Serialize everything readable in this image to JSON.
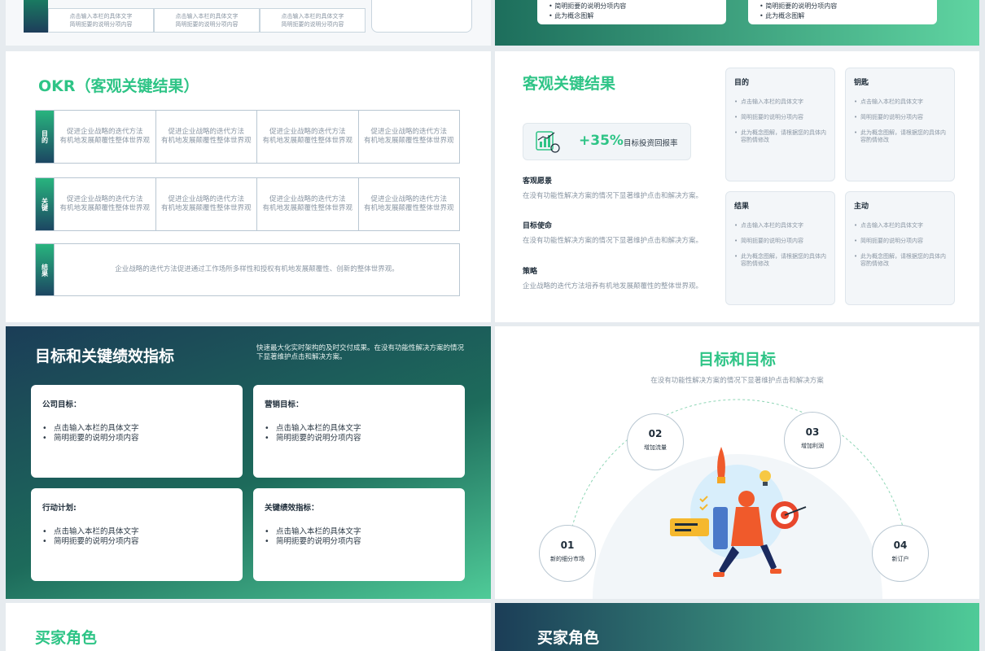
{
  "top_left": {
    "cells": [
      {
        "line1": "点击输入本栏的具体文字",
        "line2": "简明扼要的说明分项内容"
      },
      {
        "line1": "点击输入本栏的具体文字",
        "line2": "简明扼要的说明分项内容"
      },
      {
        "line1": "点击输入本栏的具体文字",
        "line2": "简明扼要的说明分项内容"
      }
    ]
  },
  "top_right": {
    "cards": [
      {
        "line1": "• 简明扼要的说明分项内容",
        "line2": "• 此为概念图解"
      },
      {
        "line1": "• 简明扼要的说明分项内容",
        "line2": "• 此为概念图解"
      }
    ]
  },
  "okr": {
    "title": "OKR（客观关键结果）",
    "rows": [
      {
        "tag": "目的",
        "cells": [
          "促进企业战略的迭代方法\n有机地发展颠覆性整体世界观",
          "促进企业战略的迭代方法\n有机地发展颠覆性整体世界观",
          "促进企业战略的迭代方法\n有机地发展颠覆性整体世界观",
          "促进企业战略的迭代方法\n有机地发展颠覆性整体世界观"
        ]
      },
      {
        "tag": "关键",
        "cells": [
          "促进企业战略的迭代方法\n有机地发展颠覆性整体世界观",
          "促进企业战略的迭代方法\n有机地发展颠覆性整体世界观",
          "促进企业战略的迭代方法\n有机地发展颠覆性整体世界观",
          "促进企业战略的迭代方法\n有机地发展颠覆性整体世界观"
        ]
      },
      {
        "tag": "结果",
        "text": "企业战略的迭代方法促进通过工作场所多样性和授权有机地发展颠覆性、创新的整体世界观。"
      }
    ]
  },
  "kr": {
    "title": "客观关键结果",
    "stat_value": "+35%",
    "stat_label": "目标投资回报率",
    "items": [
      {
        "title": "客观愿景",
        "desc": "在没有功能性解决方案的情况下显著维护点击和解决方案。"
      },
      {
        "title": "目标使命",
        "desc": "在没有功能性解决方案的情况下显著维护点击和解决方案。"
      },
      {
        "title": "策略",
        "desc": "企业战略的迭代方法培养有机地发展颠覆性的整体世界观。"
      }
    ],
    "boxes": [
      {
        "title": "目的",
        "bullets": [
          "点击输入本栏的具体文字",
          "简明扼要的说明分项内容",
          "此为概念图解，请根据您的具体内容酌情修改"
        ]
      },
      {
        "title": "钥匙",
        "bullets": [
          "点击输入本栏的具体文字",
          "简明扼要的说明分项内容",
          "此为概念图解，请根据您的具体内容酌情修改"
        ]
      },
      {
        "title": "结果",
        "bullets": [
          "点击输入本栏的具体文字",
          "简明扼要的说明分项内容",
          "此为概念图解，请根据您的具体内容酌情修改"
        ]
      },
      {
        "title": "主动",
        "bullets": [
          "点击输入本栏的具体文字",
          "简明扼要的说明分项内容",
          "此为概念图解，请根据您的具体内容酌情修改"
        ]
      }
    ]
  },
  "kpi": {
    "title": "目标和关键绩效指标",
    "subtitle": "快速最大化实时架构的及时交付成果。在没有功能性解决方案的情况下显著维护点击和解决方案。",
    "cards": [
      {
        "title": "公司目标：",
        "bullets": [
          "点击输入本栏的具体文字",
          "简明扼要的说明分项内容"
        ]
      },
      {
        "title": "营销目标：",
        "bullets": [
          "点击输入本栏的具体文字",
          "简明扼要的说明分项内容"
        ]
      },
      {
        "title": "行动计划:",
        "bullets": [
          "点击输入本栏的具体文字",
          "简明扼要的说明分项内容"
        ]
      },
      {
        "title": "关键绩效指标：",
        "bullets": [
          "点击输入本栏的具体文字",
          "简明扼要的说明分项内容"
        ]
      }
    ]
  },
  "goals": {
    "title": "目标和目标",
    "subtitle": "在没有功能性解决方案的情况下显著维护点击和解决方案",
    "nodes": [
      {
        "num": "01",
        "label": "新的细分市场"
      },
      {
        "num": "02",
        "label": "增加流量"
      },
      {
        "num": "03",
        "label": "增加利润"
      },
      {
        "num": "04",
        "label": "新订户"
      }
    ]
  },
  "buyer_left": {
    "title": "买家角色"
  },
  "buyer_right": {
    "title": "买家角色"
  },
  "colors": {
    "accent": "#2ec486",
    "dark": "#1b3d57"
  }
}
